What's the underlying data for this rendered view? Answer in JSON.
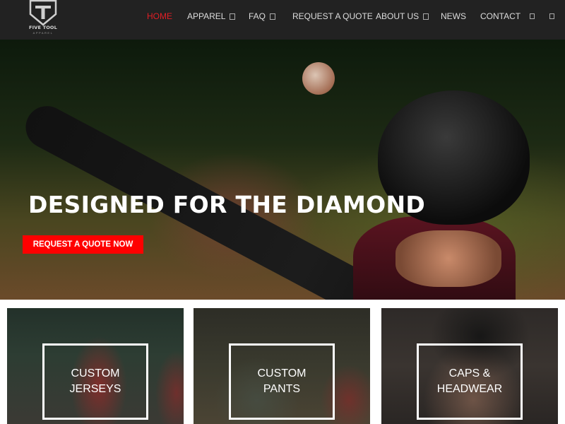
{
  "brand": {
    "name": "FIVE TOOL",
    "tagline": "APPAREL",
    "logo_icon": "shield-t-logo"
  },
  "nav": {
    "items": [
      {
        "label": "HOME",
        "active": true
      },
      {
        "label": "APPAREL",
        "has_dropdown": true
      },
      {
        "label": "FAQ",
        "has_dropdown": true
      },
      {
        "label": "REQUEST A QUOTE"
      },
      {
        "label": "ABOUT US",
        "has_dropdown": true
      },
      {
        "label": "NEWS"
      },
      {
        "label": "CONTACT"
      }
    ],
    "utility_icons": [
      "search-icon",
      "cart-icon"
    ]
  },
  "hero": {
    "title": "DESIGNED FOR THE DIAMOND",
    "cta_label": "REQUEST A QUOTE NOW"
  },
  "cards": [
    {
      "line1": "CUSTOM",
      "line2": "JERSEYS"
    },
    {
      "line1": "CUSTOM",
      "line2": "PANTS"
    },
    {
      "line1": "CAPS &",
      "line2": "HEADWEAR"
    }
  ],
  "colors": {
    "header_bg": "#222222",
    "nav_active": "#e21e25",
    "cta_bg": "#ff0000"
  }
}
